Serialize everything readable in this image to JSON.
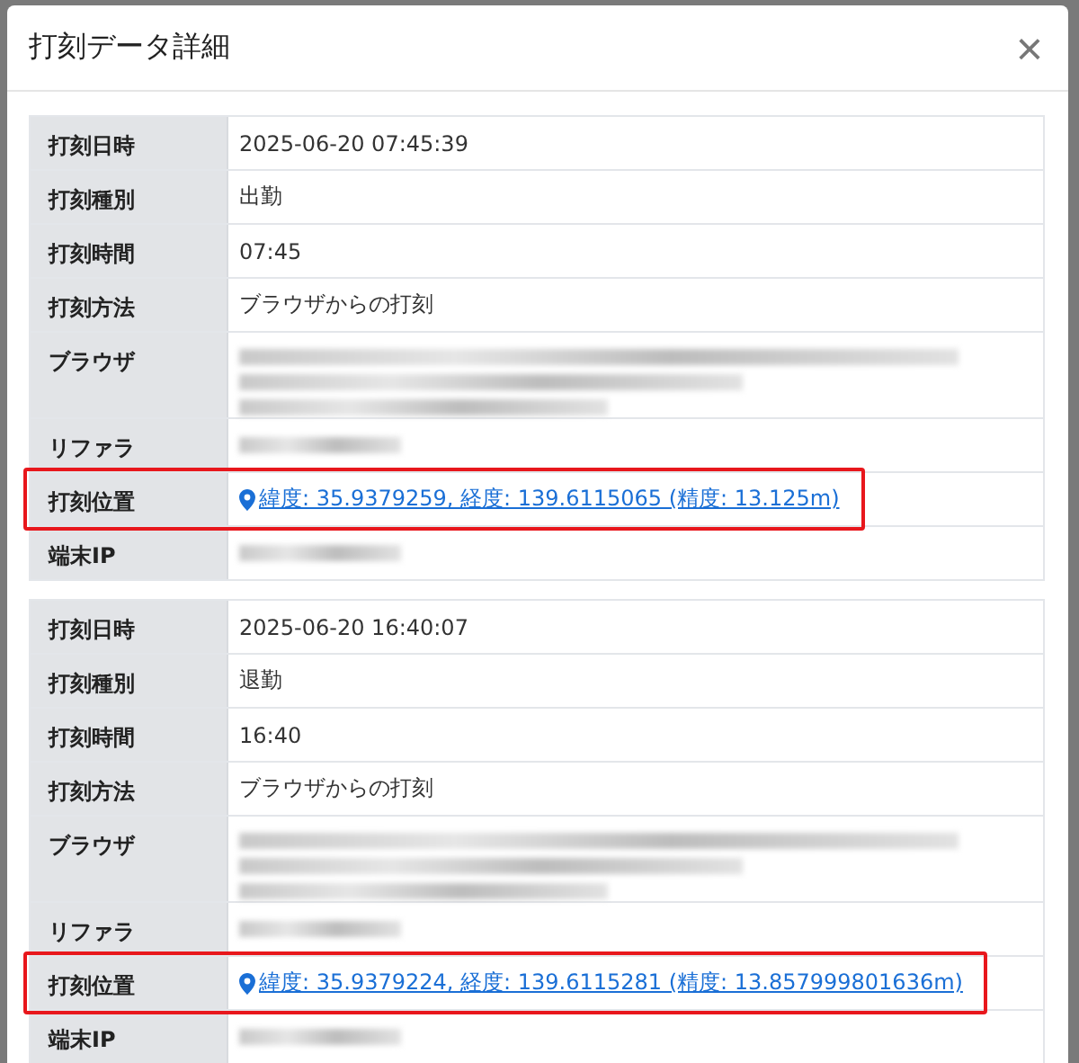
{
  "dialog": {
    "title": "打刻データ詳細",
    "close": "×"
  },
  "records": [
    {
      "rows": [
        {
          "label": "打刻日時",
          "kind": "text",
          "value": "2025-06-20 07:45:39",
          "highlighted": false
        },
        {
          "label": "打刻種別",
          "kind": "text",
          "value": "出勤",
          "highlighted": false
        },
        {
          "label": "打刻時間",
          "kind": "text",
          "value": "07:45",
          "highlighted": false
        },
        {
          "label": "打刻方法",
          "kind": "text",
          "value": "ブラウザからの打刻",
          "highlighted": false
        },
        {
          "label": "ブラウザ",
          "kind": "blurblock",
          "highlighted": false
        },
        {
          "label": "リファラ",
          "kind": "blurline",
          "highlighted": false
        },
        {
          "label": "打刻位置",
          "kind": "link",
          "value": "緯度: 35.9379259, 経度: 139.6115065 (精度: 13.125m)",
          "highlighted": true
        },
        {
          "label": "端末IP",
          "kind": "blurline",
          "highlighted": false
        }
      ]
    },
    {
      "rows": [
        {
          "label": "打刻日時",
          "kind": "text",
          "value": "2025-06-20 16:40:07",
          "highlighted": false
        },
        {
          "label": "打刻種別",
          "kind": "text",
          "value": "退勤",
          "highlighted": false
        },
        {
          "label": "打刻時間",
          "kind": "text",
          "value": "16:40",
          "highlighted": false
        },
        {
          "label": "打刻方法",
          "kind": "text",
          "value": "ブラウザからの打刻",
          "highlighted": false
        },
        {
          "label": "ブラウザ",
          "kind": "blurblock",
          "highlighted": false
        },
        {
          "label": "リファラ",
          "kind": "blurline",
          "highlighted": false
        },
        {
          "label": "打刻位置",
          "kind": "link",
          "value": "緯度: 35.9379224, 経度: 139.6115281 (精度: 13.857999801636m)",
          "highlighted": true
        },
        {
          "label": "端末IP",
          "kind": "blurline",
          "highlighted": false
        }
      ]
    }
  ]
}
